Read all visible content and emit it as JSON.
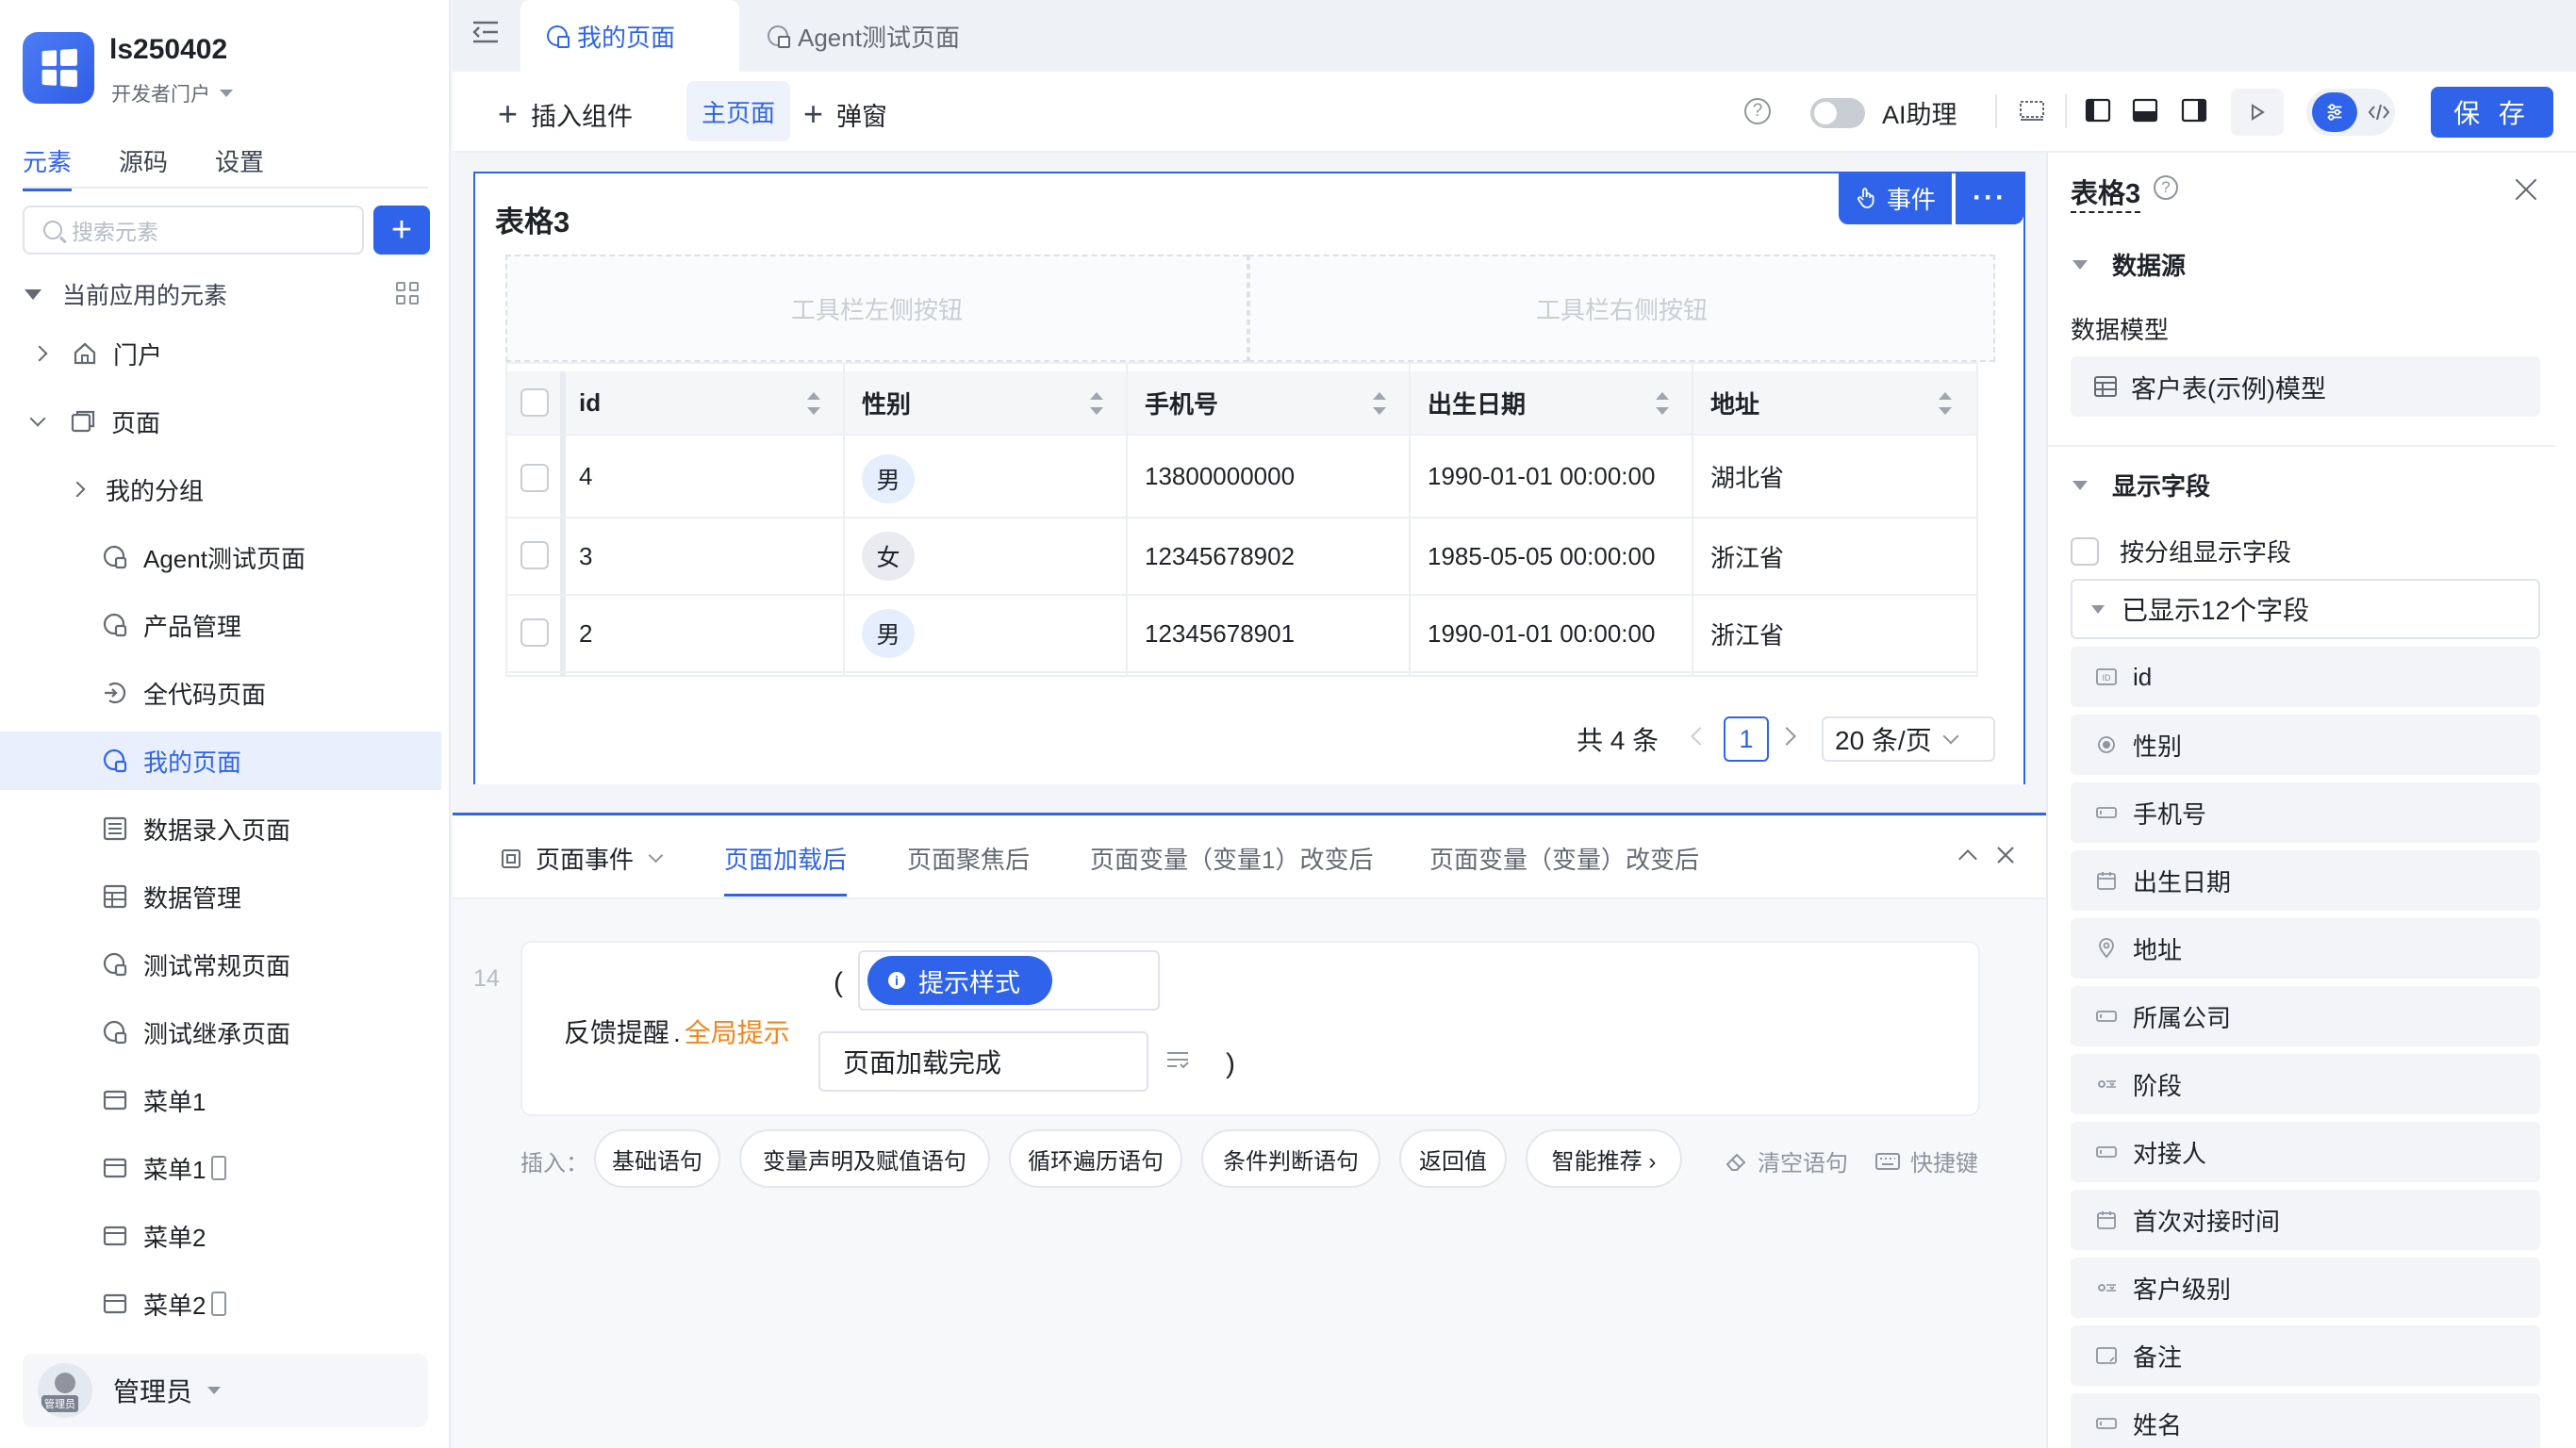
{
  "app": {
    "name": "ls250402",
    "portal": "开发者门户",
    "tabs": [
      "元素",
      "源码",
      "设置"
    ]
  },
  "sidebar": {
    "search_placeholder": "搜索元素",
    "tree_header": "当前应用的元素",
    "items": [
      {
        "label": "门户",
        "icon": "home-icon"
      },
      {
        "label": "页面",
        "icon": "pages-icon"
      },
      {
        "label": "我的分组",
        "icon": "folder-icon"
      },
      {
        "label": "Agent测试页面",
        "icon": "page-icon"
      },
      {
        "label": "产品管理",
        "icon": "page-icon"
      },
      {
        "label": "全代码页面",
        "icon": "code-page-icon"
      },
      {
        "label": "我的页面",
        "icon": "page-icon"
      },
      {
        "label": "数据录入页面",
        "icon": "form-page-icon"
      },
      {
        "label": "数据管理",
        "icon": "table-page-icon"
      },
      {
        "label": "测试常规页面",
        "icon": "page-icon"
      },
      {
        "label": "测试继承页面",
        "icon": "page-icon"
      },
      {
        "label": "菜单1",
        "icon": "menu-icon"
      },
      {
        "label": "菜单1",
        "icon": "menu-icon"
      },
      {
        "label": "菜单2",
        "icon": "menu-icon"
      },
      {
        "label": "菜单2",
        "icon": "menu-icon"
      }
    ],
    "user": {
      "name": "管理员",
      "avatar_tag": "管理员"
    }
  },
  "page_tabs": [
    "我的页面",
    "Agent测试页面"
  ],
  "toolbar": {
    "insert_component": "插入组件",
    "main_page": "主页面",
    "popup": "弹窗",
    "ai_assistant": "AI助理",
    "save": "保 存"
  },
  "table_component": {
    "title": "表格3",
    "event_button": "事件",
    "more_button": "···",
    "toolbar_left": "工具栏左侧按钮",
    "toolbar_right": "工具栏右侧按钮",
    "columns": [
      "id",
      "性别",
      "手机号",
      "出生日期",
      "地址"
    ],
    "rows": [
      {
        "id": "4",
        "gender": "男",
        "phone": "13800000000",
        "birth": "1990-01-01 00:00:00",
        "address": "湖北省"
      },
      {
        "id": "3",
        "gender": "女",
        "phone": "12345678902",
        "birth": "1985-05-05 00:00:00",
        "address": "浙江省"
      },
      {
        "id": "2",
        "gender": "男",
        "phone": "12345678901",
        "birth": "1990-01-01 00:00:00",
        "address": "浙江省"
      }
    ],
    "pagination": {
      "total": "共 4 条",
      "current_page": "1",
      "page_size": "20 条/页"
    }
  },
  "event_panel": {
    "dropdown": "页面事件",
    "tabs": [
      "页面加载后",
      "页面聚焦后",
      "页面变量（变量1）改变后",
      "页面变量（变量）改变后"
    ],
    "line_number": "14",
    "statement_object": "反馈提醒",
    "statement_dot": ".",
    "statement_method": "全局提示",
    "open_paren": "(",
    "close_paren": ")",
    "arg_style": "提示样式",
    "arg_style_icon": "i",
    "arg_message": "页面加载完成",
    "insert_label": "插入：",
    "insert_buttons": [
      "基础语句",
      "变量声明及赋值语句",
      "循环遍历语句",
      "条件判断语句",
      "返回值",
      "智能推荐 ›"
    ],
    "clear": "清空语句",
    "shortcut": "快捷键"
  },
  "right_panel": {
    "title": "表格3",
    "datasource_section": "数据源",
    "data_model_label": "数据模型",
    "data_model_value": "客户表(示例)模型",
    "fields_section": "显示字段",
    "group_checkbox": "按分组显示字段",
    "shown_fields": "已显示12个字段",
    "fields": [
      {
        "label": "id",
        "icon": "id-icon"
      },
      {
        "label": "性别",
        "icon": "radio-icon"
      },
      {
        "label": "手机号",
        "icon": "input-icon"
      },
      {
        "label": "出生日期",
        "icon": "date-icon"
      },
      {
        "label": "地址",
        "icon": "location-icon"
      },
      {
        "label": "所属公司",
        "icon": "input-icon"
      },
      {
        "label": "阶段",
        "icon": "select-icon"
      },
      {
        "label": "对接人",
        "icon": "input-icon"
      },
      {
        "label": "首次对接时间",
        "icon": "date-icon"
      },
      {
        "label": "客户级别",
        "icon": "select-icon"
      },
      {
        "label": "备注",
        "icon": "textarea-icon"
      },
      {
        "label": "姓名",
        "icon": "input-icon"
      }
    ]
  },
  "colors": {
    "primary": "#2f64ea",
    "highlight": "#f2851b",
    "gender_male_bg": "#e4eefc",
    "gender_female_bg": "#e9ebf0"
  }
}
